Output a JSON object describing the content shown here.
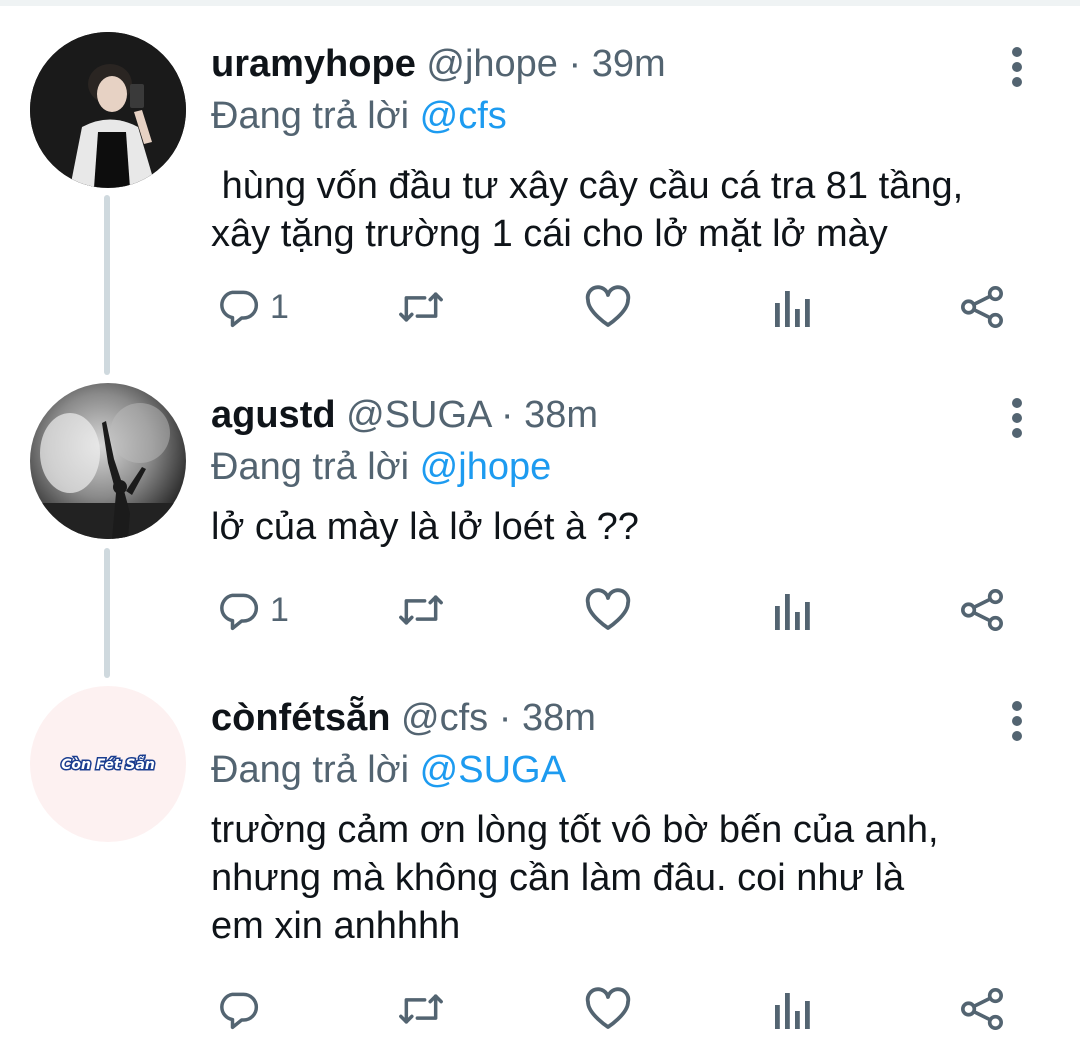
{
  "tweets": [
    {
      "display_name": "uramyhope",
      "handle": "@jhope",
      "separator": "·",
      "time": "39m",
      "replying_prefix": "Đang trả lời",
      "replying_to": "@cfs",
      "text": " hùng vốn đầu tư xây cây cầu cá tra 81 tầng,\nxây tặng trường 1 cái cho lở mặt lở mày",
      "reply_count": "1",
      "avatar": "person-taking-selfie"
    },
    {
      "display_name": "agustd",
      "handle": "@SUGA",
      "separator": "·",
      "time": "38m",
      "replying_prefix": "Đang trả lời",
      "replying_to": "@jhope",
      "text": "lở của mày là lở loét à ??",
      "reply_count": "1",
      "avatar": "performer-in-smoke"
    },
    {
      "display_name": "cònfétsẵn",
      "handle": "@cfs",
      "separator": "·",
      "time": "38m",
      "replying_prefix": "Đang trả lời",
      "replying_to": "@SUGA",
      "text": "trường cảm ơn lòng tốt vô bờ bến của anh,\nnhưng mà không cần làm đâu. coi như là\nem xin anhhhh",
      "reply_count": "",
      "avatar": "con-fet-san-logo",
      "avatar_logo_text": "Còn Fét Sẵn"
    }
  ],
  "icons": {
    "reply": "reply-icon",
    "retweet": "retweet-icon",
    "like": "like-icon",
    "analytics": "analytics-icon",
    "share": "share-icon",
    "more": "more-icon"
  },
  "colors": {
    "text": "#0f1419",
    "secondary": "#536471",
    "link": "#1d9bf0",
    "thread_line": "#cfd9de"
  }
}
